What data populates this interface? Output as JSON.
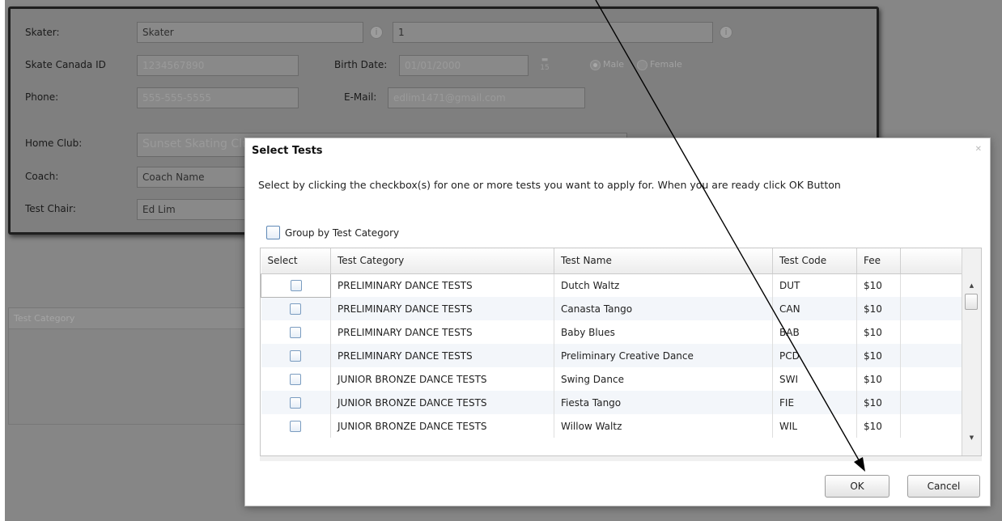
{
  "form": {
    "skater_label": "Skater:",
    "skater_first": "Skater",
    "skater_last": "1",
    "skate_canada_id_label": "Skate Canada ID",
    "skate_canada_id": "1234567890",
    "birth_date_label": "Birth Date:",
    "birth_date": "01/01/2000",
    "gender_male": "Male",
    "gender_female": "Female",
    "phone_label": "Phone:",
    "phone": "555-555-5555",
    "email_label": "E-Mail:",
    "email": "edlim1471@gmail.com",
    "home_club_label": "Home Club:",
    "home_club": "Sunset Skating Club",
    "coach_label": "Coach:",
    "coach": "Coach Name",
    "test_chair_label": "Test Chair:",
    "test_chair": "Ed Lim"
  },
  "lower_panel": {
    "header": "Test Category"
  },
  "dialog": {
    "title": "Select Tests",
    "instruction": "Select by clicking the checkbox(s) for one or more tests you want to apply for.  When you are ready click OK Button",
    "group_label": "Group by Test Category",
    "columns": [
      "Select",
      "Test Category",
      "Test Name",
      "Test Code",
      "Fee"
    ],
    "rows": [
      {
        "category": "PRELIMINARY DANCE TESTS",
        "name": "Dutch Waltz",
        "code": "DUT",
        "fee": "$10"
      },
      {
        "category": "PRELIMINARY DANCE TESTS",
        "name": "Canasta Tango",
        "code": "CAN",
        "fee": "$10"
      },
      {
        "category": "PRELIMINARY DANCE TESTS",
        "name": "Baby Blues",
        "code": "BAB",
        "fee": "$10"
      },
      {
        "category": "PRELIMINARY DANCE TESTS",
        "name": "Preliminary Creative Dance",
        "code": "PCD",
        "fee": "$10"
      },
      {
        "category": "JUNIOR BRONZE DANCE TESTS",
        "name": "Swing Dance",
        "code": "SWI",
        "fee": "$10"
      },
      {
        "category": "JUNIOR BRONZE DANCE TESTS",
        "name": "Fiesta Tango",
        "code": "FIE",
        "fee": "$10"
      },
      {
        "category": "JUNIOR BRONZE DANCE TESTS",
        "name": "Willow Waltz",
        "code": "WIL",
        "fee": "$10"
      }
    ],
    "ok_label": "OK",
    "cancel_label": "Cancel"
  }
}
